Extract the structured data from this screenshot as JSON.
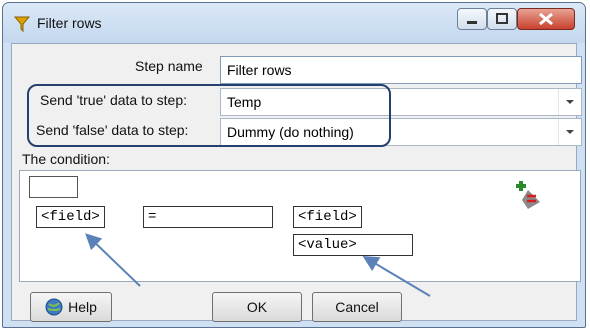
{
  "window": {
    "title": "Filter rows"
  },
  "form": {
    "step_name_label": "Step name",
    "step_name_value": "Filter rows",
    "true_label": "Send 'true' data to step:",
    "true_value": "Temp",
    "false_label": "Send 'false' data to step:",
    "false_value": "Dummy (do nothing)",
    "condition_label": "The condition:"
  },
  "condition": {
    "left_field": "<field>",
    "operator": "=",
    "right_field": "<field>",
    "right_value": "<value>"
  },
  "buttons": {
    "help": "Help",
    "ok": "OK",
    "cancel": "Cancel"
  },
  "colors": {
    "highlight": "#25406e",
    "arrow": "#5b82b8"
  }
}
